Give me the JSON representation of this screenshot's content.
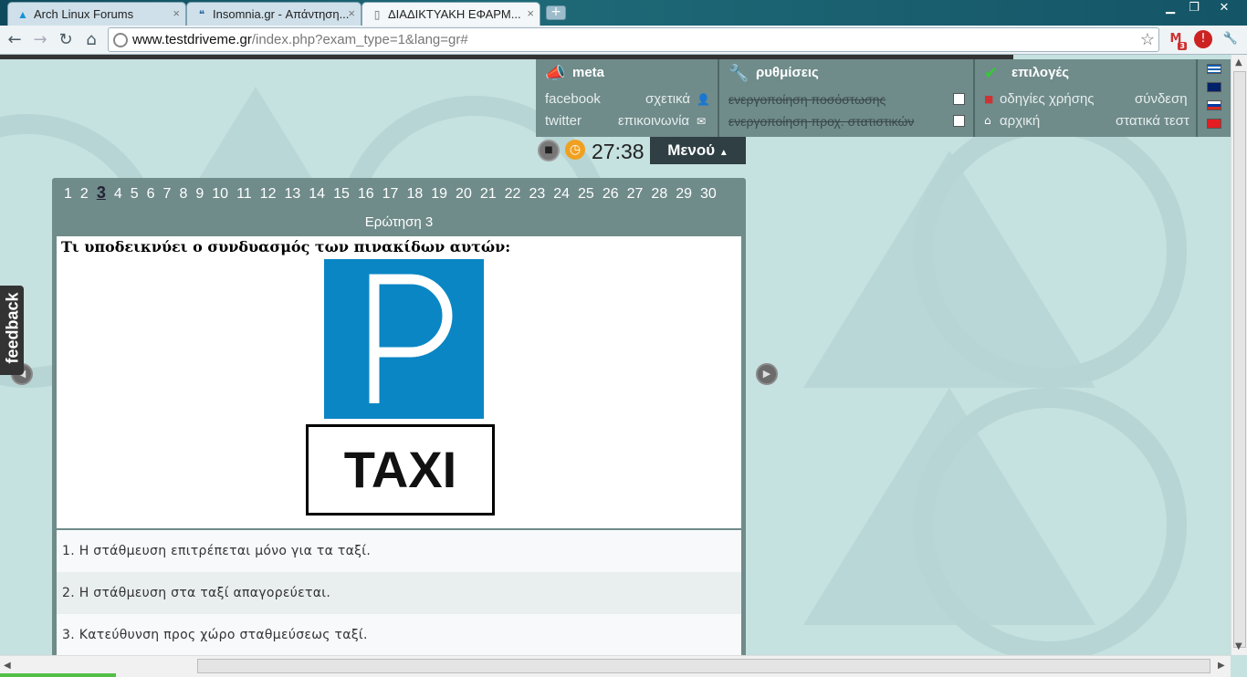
{
  "browser": {
    "tabs": [
      {
        "title": "Arch Linux Forums",
        "icon": "arch-icon"
      },
      {
        "title": "Insomnia.gr - Απάντηση...",
        "icon": "quote-icon"
      },
      {
        "title": "ΔΙΑΔΙΚΤΥΑΚΗ ΕΦΑΡΜ...",
        "icon": "page-icon"
      }
    ],
    "url_host": "www.testdriveme.gr",
    "url_path": "/index.php?exam_type=1&lang=gr#",
    "gmail_count": "3"
  },
  "topmenu": {
    "meta": {
      "title": "meta",
      "links": [
        "facebook",
        "σχετικά",
        "twitter",
        "επικοινωνία"
      ]
    },
    "settings": {
      "title": "ρυθμίσεις",
      "options": [
        "ενεργοποίηση ποσόστωσης",
        "ενεργοποίηση προχ. στατιστικών"
      ]
    },
    "choices": {
      "title": "επιλογές",
      "links": [
        "οδηγίες χρήσης",
        "σύνδεση",
        "αρχική",
        "στατικά τεστ"
      ]
    }
  },
  "timer": {
    "value": "27:38",
    "menu_label": "Μενού"
  },
  "quiz": {
    "question_numbers": [
      "1",
      "2",
      "3",
      "4",
      "5",
      "6",
      "7",
      "8",
      "9",
      "10",
      "11",
      "12",
      "13",
      "14",
      "15",
      "16",
      "17",
      "18",
      "19",
      "20",
      "21",
      "22",
      "23",
      "24",
      "25",
      "26",
      "27",
      "28",
      "29",
      "30"
    ],
    "current": "3",
    "header": "Ερώτηση 3",
    "question": "Τι υποδεικνύει ο συνδυασμός των πινακίδων αυτών:",
    "sign_text": "TAXI",
    "answers": [
      "1. Η στάθμευση επιτρέπεται μόνο για τα ταξί.",
      "2. Η στάθμευση στα ταξί απαγορεύεται.",
      "3. Κατεύθυνση προς χώρο σταθμεύσεως ταξί."
    ]
  },
  "feedback_label": "feedback"
}
